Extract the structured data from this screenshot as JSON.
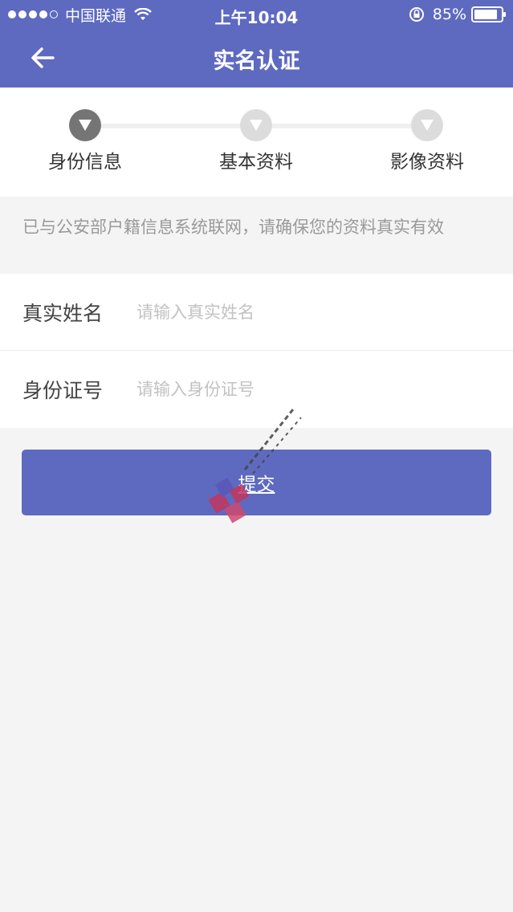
{
  "status_bar": {
    "carrier": "中国联通",
    "time": "上午10:04",
    "battery": "85%"
  },
  "nav": {
    "title": "实名认证",
    "back_icon": "arrow-left-icon"
  },
  "steps": [
    {
      "label": "身份信息",
      "active": true,
      "icon": "chevron-down-icon"
    },
    {
      "label": "基本资料",
      "active": false,
      "icon": "chevron-down-icon"
    },
    {
      "label": "影像资料",
      "active": false,
      "icon": "chevron-down-icon"
    }
  ],
  "notice": "已与公安部户籍信息系统联网，请确保您的资料真实有效",
  "form": {
    "name_label": "真实姓名",
    "name_placeholder": "请输入真实姓名",
    "id_label": "身份证号",
    "id_placeholder": "请输入身份证号"
  },
  "submit_label": "提交",
  "colors": {
    "primary": "#5e6ac0",
    "background": "#f4f4f4",
    "step_active": "#757575",
    "step_inactive": "#dcdcdc"
  }
}
